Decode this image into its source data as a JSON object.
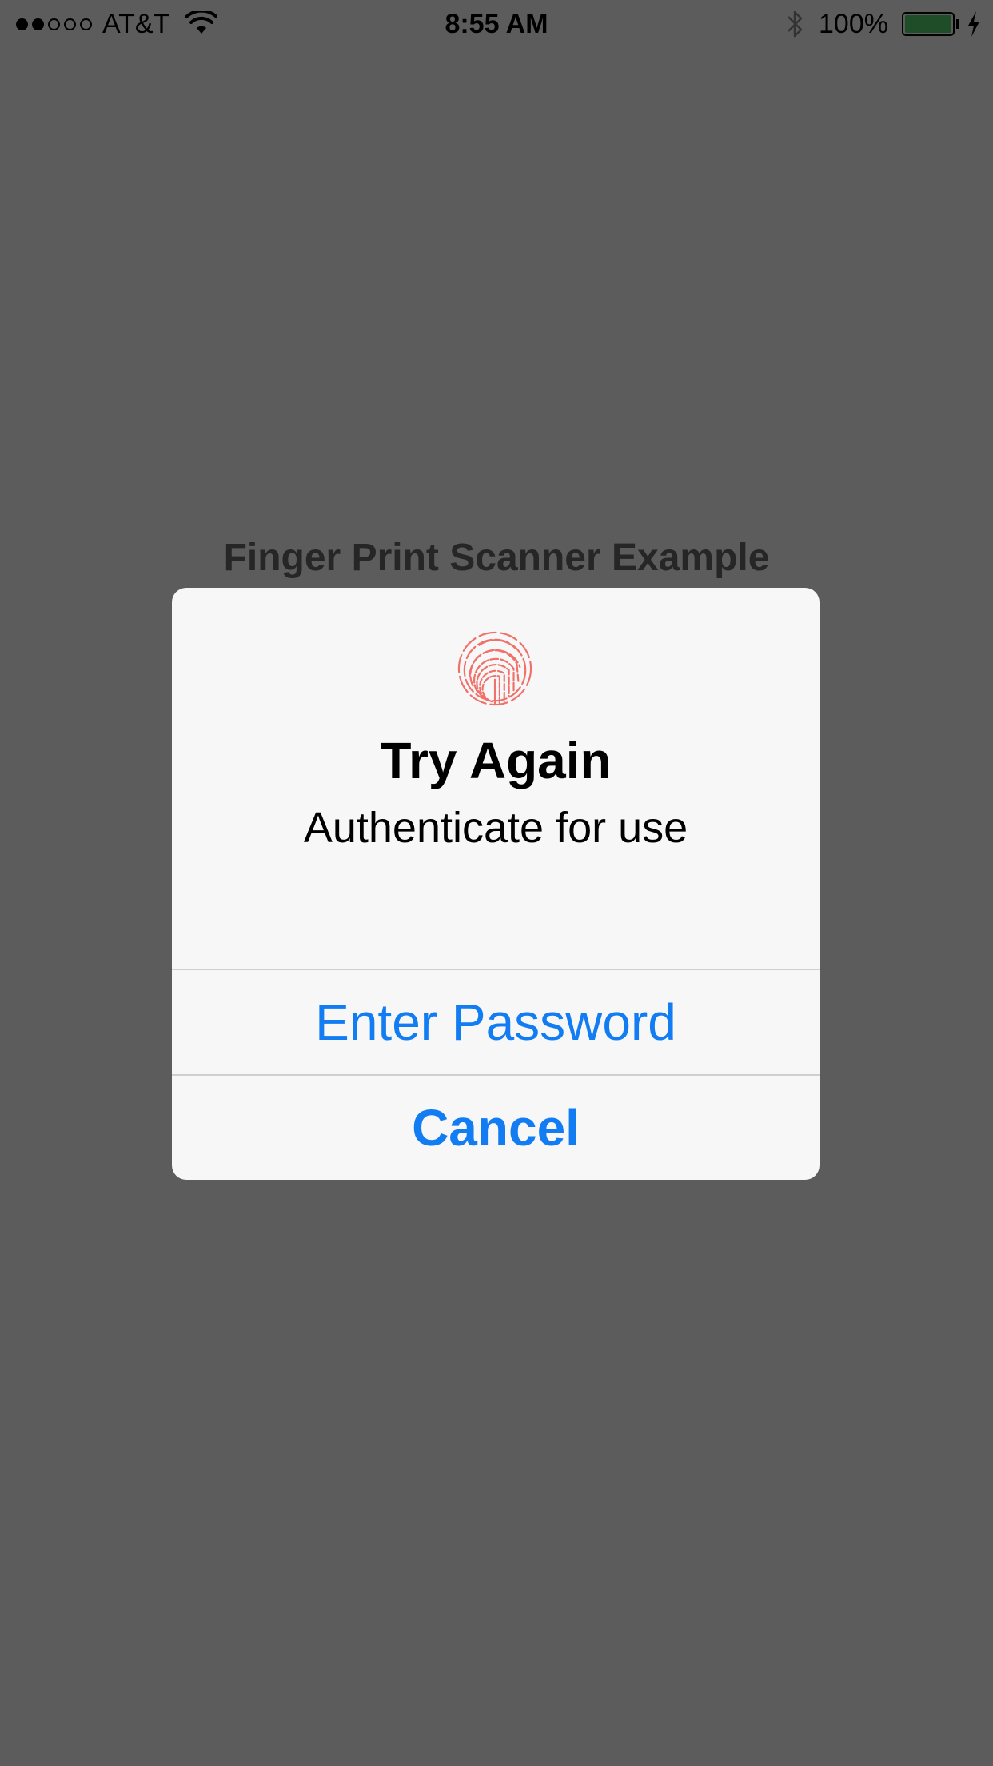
{
  "status_bar": {
    "signal_dots": [
      true,
      true,
      false,
      false,
      false
    ],
    "carrier": "AT&T",
    "wifi_icon": "wifi-icon",
    "time": "8:55 AM",
    "bluetooth_icon": "bluetooth-icon",
    "battery_percent": "100%",
    "battery_level": 1.0,
    "battery_color": "#1f4d27",
    "charging_icon": "charging-bolt-icon"
  },
  "page": {
    "title": "Finger Print Scanner Example"
  },
  "dialog": {
    "icon": "fingerprint-icon",
    "icon_color": "#f0706a",
    "title": "Try Again",
    "message": "Authenticate for use",
    "buttons": [
      {
        "label": "Enter Password",
        "style": "default"
      },
      {
        "label": "Cancel",
        "style": "bold"
      }
    ],
    "button_color": "#127cf3"
  },
  "colors": {
    "dim_background": "#5c5c5c",
    "dialog_background": "#f7f7f7"
  }
}
